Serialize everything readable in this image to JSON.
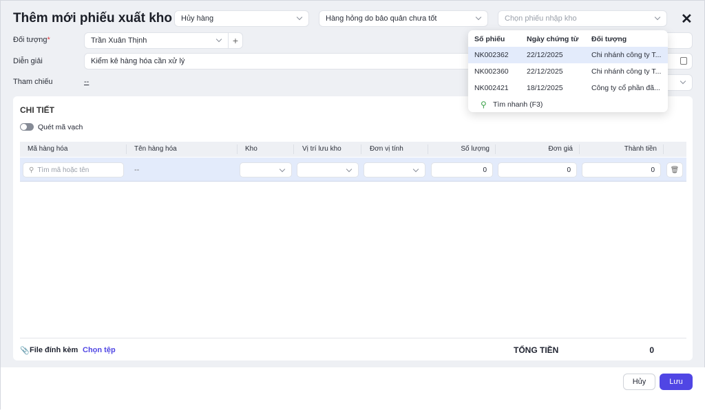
{
  "header": {
    "title": "Thêm mới phiếu xuất kho",
    "reason_select": "Hủy hàng",
    "reason_detail_select": "Hàng hỏng do bảo quản chưa tốt",
    "receipt_placeholder": "Chọn phiếu nhập kho"
  },
  "form": {
    "object_label": "Đối tượng",
    "required_mark": "*",
    "object_value": "Trần Xuân Thịnh",
    "description_label": "Diễn giải",
    "description_value": "Kiểm kê hàng hóa cần xử lý",
    "reference_label": "Tham chiếu",
    "reference_value": "--"
  },
  "popup": {
    "columns": [
      "Số phiếu",
      "Ngày chứng từ",
      "Đối tượng"
    ],
    "rows": [
      [
        "NK002362",
        "22/12/2025",
        "Chi nhánh công ty T..."
      ],
      [
        "NK002360",
        "22/12/2025",
        "Chi nhánh công ty T..."
      ],
      [
        "NK002421",
        "18/12/2025",
        "Công ty cổ phần đã..."
      ]
    ],
    "quick_search": "Tìm nhanh (F3)"
  },
  "detail": {
    "title": "CHI TIẾT",
    "barcode_label": "Quét mã vạch",
    "columns": [
      "Mã hàng hóa",
      "Tên hàng hóa",
      "Kho",
      "Vị trí lưu kho",
      "Đơn vị tính",
      "Số lượng",
      "Đơn giá",
      "Thành tiền"
    ],
    "row": {
      "search_placeholder": "Tìm mã hoặc tên",
      "name": "--",
      "quantity": "0",
      "price": "0",
      "amount": "0"
    }
  },
  "footer": {
    "attachment_label": "File đính kèm",
    "choose_file": "Chọn tệp",
    "total_label": "TỔNG TIỀN",
    "total_value": "0"
  },
  "actions": {
    "cancel": "Hủy",
    "save": "Lưu"
  },
  "colors": {
    "primary": "#5046e4",
    "row_highlight": "#e3ebfb"
  }
}
